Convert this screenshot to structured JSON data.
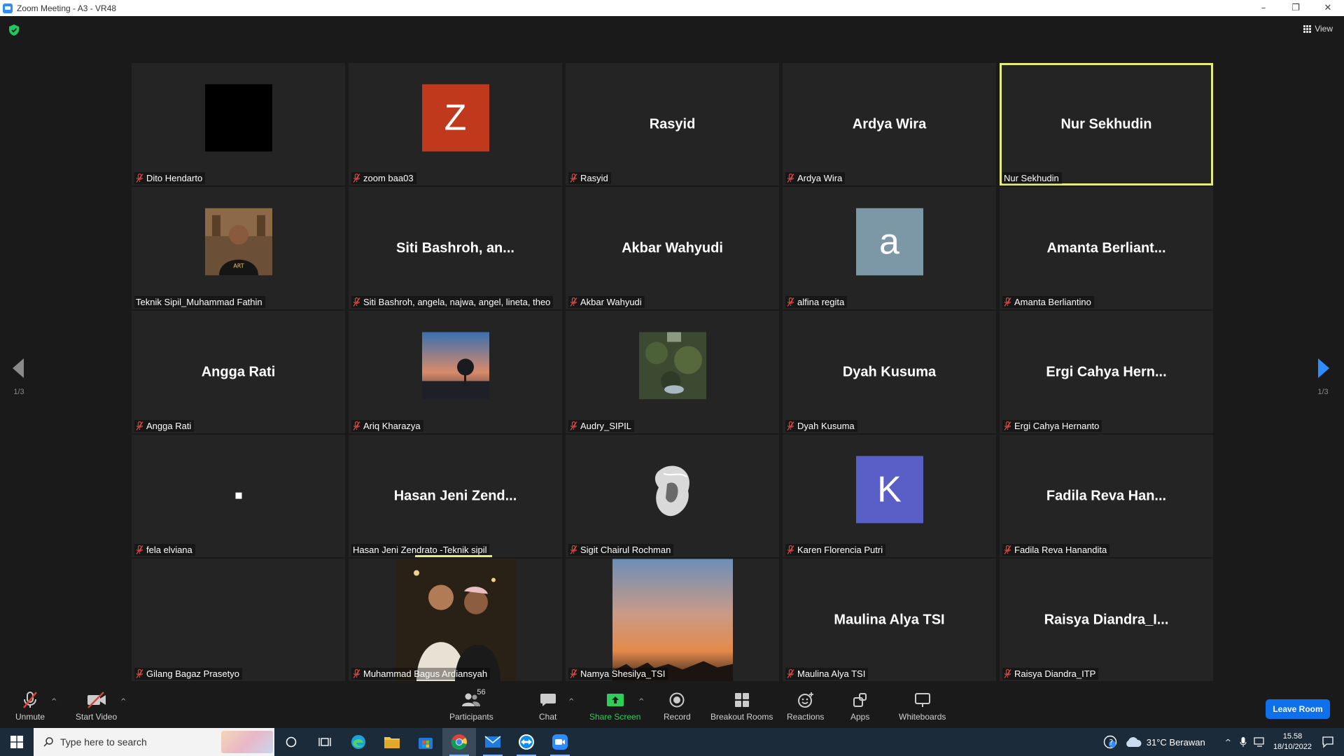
{
  "window": {
    "title": "Zoom Meeting - A3 - VR48",
    "controls": [
      "–",
      "❐",
      "✕"
    ]
  },
  "top_bar": {
    "view_label": "View"
  },
  "pagination": {
    "left": "1/3",
    "right": "1/3"
  },
  "tiles": [
    {
      "big": "",
      "label": "Dito Hendarto",
      "muted": true,
      "avatar": {
        "type": "box",
        "color": "#000000",
        "letter": ""
      }
    },
    {
      "big": "",
      "label": "zoom baa03",
      "muted": true,
      "avatar": {
        "type": "box",
        "color": "#c0391d",
        "letter": "Z"
      }
    },
    {
      "big": "Rasyid",
      "label": "Rasyid",
      "muted": true
    },
    {
      "big": "Ardya Wira",
      "label": "Ardya Wira",
      "muted": true
    },
    {
      "big": "Nur Sekhudin",
      "label": "Nur Sekhudin",
      "muted": false,
      "active": true
    },
    {
      "big": "",
      "label": "Teknik Sipil_Muhammad Fathin",
      "muted": false,
      "photo": "person-photo"
    },
    {
      "big": "Siti Bashroh, an...",
      "label": "Siti Bashroh, angela, najwa, angel, lineta, theo",
      "muted": true
    },
    {
      "big": "Akbar Wahyudi",
      "label": "Akbar Wahyudi",
      "muted": true
    },
    {
      "big": "",
      "label": "alfina regita",
      "muted": true,
      "avatar": {
        "type": "box",
        "color": "#7c97a6",
        "letter": "a"
      }
    },
    {
      "big": "Amanta Berliant...",
      "label": "Amanta Berliantino",
      "muted": true
    },
    {
      "big": "Angga Rati",
      "label": "Angga Rati",
      "muted": true
    },
    {
      "big": "",
      "label": "Ariq Kharazya",
      "muted": true,
      "photo": "sunset-tree"
    },
    {
      "big": "",
      "label": "Audry_SIPIL",
      "muted": true,
      "photo": "garden"
    },
    {
      "big": "Dyah Kusuma",
      "label": "Dyah Kusuma",
      "muted": true
    },
    {
      "big": "Ergi Cahya Hern...",
      "label": "Ergi Cahya Hernanto",
      "muted": true
    },
    {
      "big": "",
      "label": "fela elviana",
      "muted": true,
      "dot": true
    },
    {
      "big": "Hasan Jeni Zend...",
      "label": "Hasan Jeni Zendrato -Teknik sipil",
      "muted": false,
      "speaking": true
    },
    {
      "big": "",
      "label": "Sigit Chairul Rochman",
      "muted": true,
      "photo": "lion-sketch"
    },
    {
      "big": "",
      "label": "Karen Florencia Putri",
      "muted": true,
      "avatar": {
        "type": "box",
        "color": "#5a5fc7",
        "letter": "K"
      }
    },
    {
      "big": "Fadila Reva Han...",
      "label": "Fadila Reva Hanandita",
      "muted": true
    },
    {
      "big": "",
      "label": "Gilang Bagaz Prasetyo",
      "muted": true
    },
    {
      "big": "",
      "label": "Muhammad Bagus Ardiansyah",
      "muted": true,
      "photo": "two-people"
    },
    {
      "big": "",
      "label": "Namya Shesilya_TSI",
      "muted": true,
      "photo": "sky-sunset"
    },
    {
      "big": "Maulina Alya TSI",
      "label": "Maulina Alya TSI",
      "muted": true
    },
    {
      "big": "Raisya Diandra_I...",
      "label": "Raisya Diandra_ITP",
      "muted": true
    }
  ],
  "toolbar": {
    "unmute": "Unmute",
    "start_video": "Start Video",
    "participants": "Participants",
    "participants_count": "56",
    "chat": "Chat",
    "share_screen": "Share Screen",
    "record": "Record",
    "breakout_rooms": "Breakout Rooms",
    "reactions": "Reactions",
    "apps": "Apps",
    "whiteboards": "Whiteboards",
    "leave": "Leave Room"
  },
  "taskbar": {
    "search_placeholder": "Type here to search",
    "weather": "31°C  Berawan",
    "time": "15.58",
    "date": "18/10/2022"
  },
  "colors": {
    "accent_blue": "#0e71eb",
    "active_speaker": "#e6ec7a",
    "share_green": "#2dcd5a",
    "mute_red": "#e0413c"
  }
}
